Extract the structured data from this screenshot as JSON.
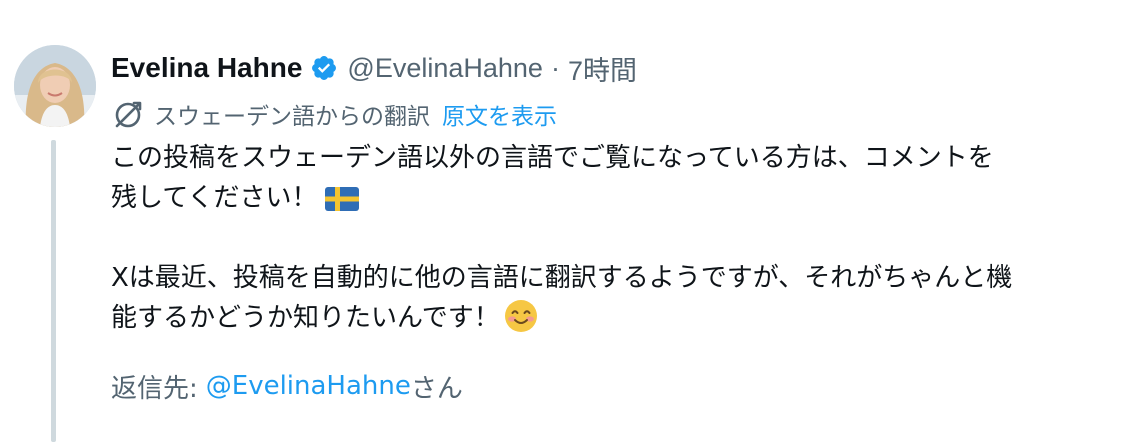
{
  "author": {
    "display_name": "Evelina Hahne",
    "handle": "@EvelinaHahne",
    "separator": "·",
    "time": "7時間",
    "verified_color": "#1d9bf0"
  },
  "translation": {
    "translated_from": "スウェーデン語からの翻訳",
    "show_original": "原文を表示",
    "icon": "translate-icon"
  },
  "body": {
    "line1": "この投稿をスウェーデン語以外の言語でご覧になっている方は、コメントを",
    "line2": "残してください！",
    "line3": "Xは最近、投稿を自動的に他の言語に翻訳するようですが、それがちゃんと機",
    "line4": "能するかどうか知りたいんです！",
    "emoji1": "sweden-flag-icon",
    "emoji2": "smiling-face-icon"
  },
  "reply": {
    "label": "返信先:",
    "handle": "@EvelinaHahne",
    "suffix": "さん"
  },
  "colors": {
    "text": "#0f1419",
    "secondary": "#536471",
    "link": "#1d9bf0",
    "thread_line": "#cfd9de"
  }
}
